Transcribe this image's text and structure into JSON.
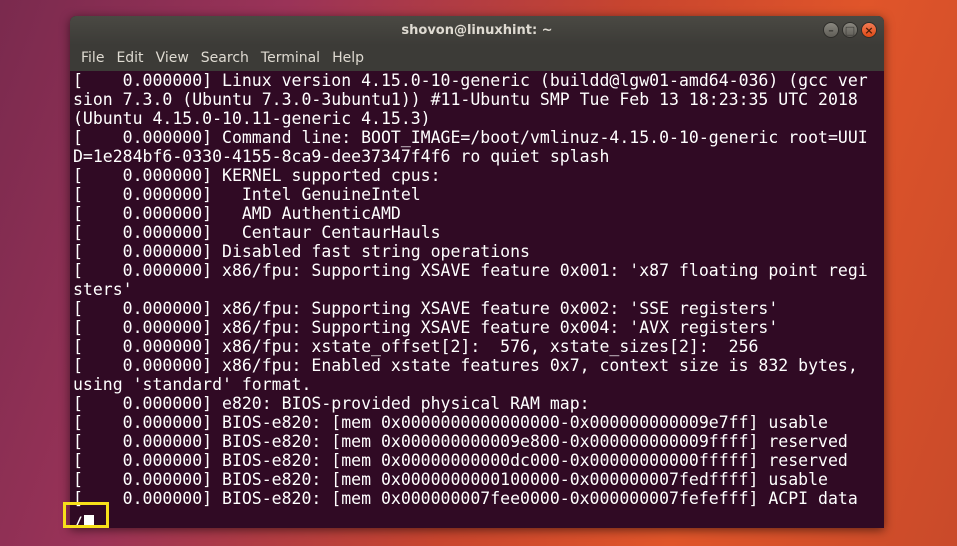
{
  "window": {
    "title": "shovon@linuxhint: ~",
    "controls": {
      "minimize": "–",
      "maximize": "□",
      "close": "×"
    }
  },
  "menubar": [
    "File",
    "Edit",
    "View",
    "Search",
    "Terminal",
    "Help"
  ],
  "terminal": {
    "lines": [
      "[    0.000000] Linux version 4.15.0-10-generic (buildd@lgw01-amd64-036) (gcc ver",
      "sion 7.3.0 (Ubuntu 7.3.0-3ubuntu1)) #11-Ubuntu SMP Tue Feb 13 18:23:35 UTC 2018",
      "(Ubuntu 4.15.0-10.11-generic 4.15.3)",
      "[    0.000000] Command line: BOOT_IMAGE=/boot/vmlinuz-4.15.0-10-generic root=UUI",
      "D=1e284bf6-0330-4155-8ca9-dee37347f4f6 ro quiet splash",
      "[    0.000000] KERNEL supported cpus:",
      "[    0.000000]   Intel GenuineIntel",
      "[    0.000000]   AMD AuthenticAMD",
      "[    0.000000]   Centaur CentaurHauls",
      "[    0.000000] Disabled fast string operations",
      "[    0.000000] x86/fpu: Supporting XSAVE feature 0x001: 'x87 floating point regi",
      "sters'",
      "[    0.000000] x86/fpu: Supporting XSAVE feature 0x002: 'SSE registers'",
      "[    0.000000] x86/fpu: Supporting XSAVE feature 0x004: 'AVX registers'",
      "[    0.000000] x86/fpu: xstate_offset[2]:  576, xstate_sizes[2]:  256",
      "[    0.000000] x86/fpu: Enabled xstate features 0x7, context size is 832 bytes,",
      "using 'standard' format.",
      "[    0.000000] e820: BIOS-provided physical RAM map:",
      "[    0.000000] BIOS-e820: [mem 0x0000000000000000-0x000000000009e7ff] usable",
      "[    0.000000] BIOS-e820: [mem 0x000000000009e800-0x000000000009ffff] reserved",
      "[    0.000000] BIOS-e820: [mem 0x00000000000dc000-0x00000000000fffff] reserved",
      "[    0.000000] BIOS-e820: [mem 0x0000000000100000-0x000000007fedffff] usable",
      "[    0.000000] BIOS-e820: [mem 0x000000007fee0000-0x000000007fefefff] ACPI data"
    ],
    "prompt": "/"
  },
  "colors": {
    "terminal_bg": "#300a24",
    "text": "#ffffff",
    "highlight": "#f7e01a"
  }
}
